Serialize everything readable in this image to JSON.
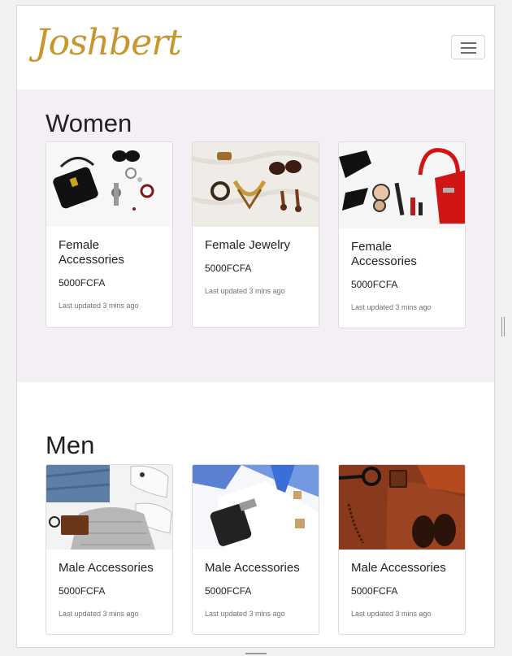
{
  "brand": {
    "name": "Joshbert",
    "color": "#c7962f"
  },
  "nav": {
    "menu_icon": "hamburger-icon"
  },
  "sections": [
    {
      "title": "Women",
      "background": "#f4eef5",
      "cards": [
        {
          "title": "Female Accessories",
          "price": "5000FCFA",
          "updated": "Last updated 3 mins ago"
        },
        {
          "title": "Female Jewelry",
          "price": "5000FCFA",
          "updated": "Last updated 3 mins ago"
        },
        {
          "title": "Female Accessories",
          "price": "5000FCFA",
          "updated": "Last updated 3 mins ago"
        }
      ]
    },
    {
      "title": "Men",
      "background": "#ffffff",
      "cards": [
        {
          "title": "Male Accessories",
          "price": "5000FCFA",
          "updated": "Last updated 3 mins ago"
        },
        {
          "title": "Male Accessories",
          "price": "5000FCFA",
          "updated": "Last updated 3 mins ago"
        },
        {
          "title": "Male Accessories",
          "price": "5000FCFA",
          "updated": "Last updated 3 mins ago"
        }
      ]
    }
  ]
}
